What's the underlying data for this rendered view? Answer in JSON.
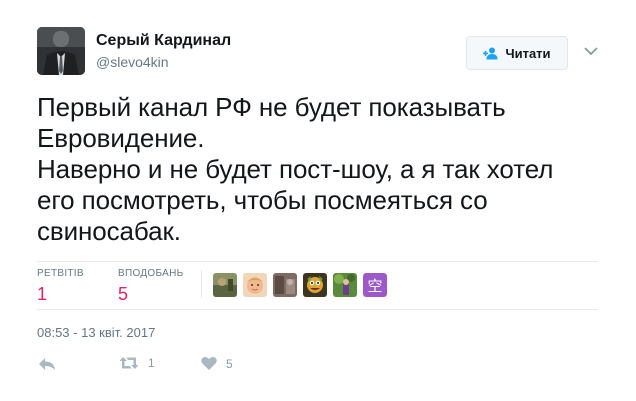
{
  "user": {
    "name": "Серый Кардинал",
    "handle": "@slevo4kin"
  },
  "follow_button": {
    "label": "Читати"
  },
  "tweet": {
    "lines": [
      "Первый канал РФ не будет показывать",
      "Евровидение.",
      "Наверно и не будет пост-шоу, а я так хотел",
      "его посмотреть, чтобы посмеяться со",
      "свиносабак."
    ]
  },
  "stats": {
    "retweets_label": "РЕТВІТІВ",
    "retweets_value": "1",
    "likes_label": "ВПОДОБАНЬ",
    "likes_value": "5"
  },
  "liker_avatars": [
    {
      "icon": "user-avatar-photo",
      "color": "#6f7a52"
    },
    {
      "icon": "user-avatar-child",
      "color": "#e9b48a"
    },
    {
      "icon": "user-avatar-photo",
      "color": "#6b5b55"
    },
    {
      "icon": "user-avatar-cartoon",
      "color": "#3d3520"
    },
    {
      "icon": "user-avatar-photo",
      "color": "#4f7a3a"
    },
    {
      "icon": "user-avatar-glyph",
      "color": "#9b59c9",
      "glyph": "空"
    }
  ],
  "timestamp": "08:53 - 13 квіт. 2017",
  "actions": {
    "reply_icon": "reply-icon",
    "retweet_icon": "retweet-icon",
    "retweet_count": "1",
    "like_icon": "heart-icon",
    "like_count": "5"
  },
  "colors": {
    "text": "#14171a",
    "muted": "#657786",
    "accent_like": "#e0245e",
    "divider": "#e6ecf0"
  }
}
